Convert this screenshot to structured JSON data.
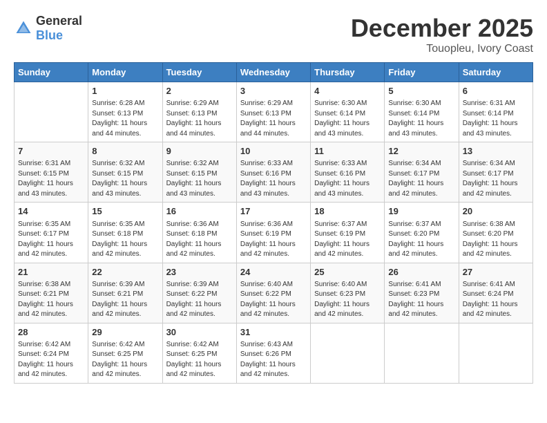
{
  "header": {
    "logo_general": "General",
    "logo_blue": "Blue",
    "month": "December 2025",
    "location": "Touopleu, Ivory Coast"
  },
  "days_of_week": [
    "Sunday",
    "Monday",
    "Tuesday",
    "Wednesday",
    "Thursday",
    "Friday",
    "Saturday"
  ],
  "weeks": [
    [
      {
        "day": "",
        "sunrise": "",
        "sunset": "",
        "daylight": ""
      },
      {
        "day": "1",
        "sunrise": "Sunrise: 6:28 AM",
        "sunset": "Sunset: 6:13 PM",
        "daylight": "Daylight: 11 hours and 44 minutes."
      },
      {
        "day": "2",
        "sunrise": "Sunrise: 6:29 AM",
        "sunset": "Sunset: 6:13 PM",
        "daylight": "Daylight: 11 hours and 44 minutes."
      },
      {
        "day": "3",
        "sunrise": "Sunrise: 6:29 AM",
        "sunset": "Sunset: 6:13 PM",
        "daylight": "Daylight: 11 hours and 44 minutes."
      },
      {
        "day": "4",
        "sunrise": "Sunrise: 6:30 AM",
        "sunset": "Sunset: 6:14 PM",
        "daylight": "Daylight: 11 hours and 43 minutes."
      },
      {
        "day": "5",
        "sunrise": "Sunrise: 6:30 AM",
        "sunset": "Sunset: 6:14 PM",
        "daylight": "Daylight: 11 hours and 43 minutes."
      },
      {
        "day": "6",
        "sunrise": "Sunrise: 6:31 AM",
        "sunset": "Sunset: 6:14 PM",
        "daylight": "Daylight: 11 hours and 43 minutes."
      }
    ],
    [
      {
        "day": "7",
        "sunrise": "Sunrise: 6:31 AM",
        "sunset": "Sunset: 6:15 PM",
        "daylight": "Daylight: 11 hours and 43 minutes."
      },
      {
        "day": "8",
        "sunrise": "Sunrise: 6:32 AM",
        "sunset": "Sunset: 6:15 PM",
        "daylight": "Daylight: 11 hours and 43 minutes."
      },
      {
        "day": "9",
        "sunrise": "Sunrise: 6:32 AM",
        "sunset": "Sunset: 6:15 PM",
        "daylight": "Daylight: 11 hours and 43 minutes."
      },
      {
        "day": "10",
        "sunrise": "Sunrise: 6:33 AM",
        "sunset": "Sunset: 6:16 PM",
        "daylight": "Daylight: 11 hours and 43 minutes."
      },
      {
        "day": "11",
        "sunrise": "Sunrise: 6:33 AM",
        "sunset": "Sunset: 6:16 PM",
        "daylight": "Daylight: 11 hours and 43 minutes."
      },
      {
        "day": "12",
        "sunrise": "Sunrise: 6:34 AM",
        "sunset": "Sunset: 6:17 PM",
        "daylight": "Daylight: 11 hours and 42 minutes."
      },
      {
        "day": "13",
        "sunrise": "Sunrise: 6:34 AM",
        "sunset": "Sunset: 6:17 PM",
        "daylight": "Daylight: 11 hours and 42 minutes."
      }
    ],
    [
      {
        "day": "14",
        "sunrise": "Sunrise: 6:35 AM",
        "sunset": "Sunset: 6:17 PM",
        "daylight": "Daylight: 11 hours and 42 minutes."
      },
      {
        "day": "15",
        "sunrise": "Sunrise: 6:35 AM",
        "sunset": "Sunset: 6:18 PM",
        "daylight": "Daylight: 11 hours and 42 minutes."
      },
      {
        "day": "16",
        "sunrise": "Sunrise: 6:36 AM",
        "sunset": "Sunset: 6:18 PM",
        "daylight": "Daylight: 11 hours and 42 minutes."
      },
      {
        "day": "17",
        "sunrise": "Sunrise: 6:36 AM",
        "sunset": "Sunset: 6:19 PM",
        "daylight": "Daylight: 11 hours and 42 minutes."
      },
      {
        "day": "18",
        "sunrise": "Sunrise: 6:37 AM",
        "sunset": "Sunset: 6:19 PM",
        "daylight": "Daylight: 11 hours and 42 minutes."
      },
      {
        "day": "19",
        "sunrise": "Sunrise: 6:37 AM",
        "sunset": "Sunset: 6:20 PM",
        "daylight": "Daylight: 11 hours and 42 minutes."
      },
      {
        "day": "20",
        "sunrise": "Sunrise: 6:38 AM",
        "sunset": "Sunset: 6:20 PM",
        "daylight": "Daylight: 11 hours and 42 minutes."
      }
    ],
    [
      {
        "day": "21",
        "sunrise": "Sunrise: 6:38 AM",
        "sunset": "Sunset: 6:21 PM",
        "daylight": "Daylight: 11 hours and 42 minutes."
      },
      {
        "day": "22",
        "sunrise": "Sunrise: 6:39 AM",
        "sunset": "Sunset: 6:21 PM",
        "daylight": "Daylight: 11 hours and 42 minutes."
      },
      {
        "day": "23",
        "sunrise": "Sunrise: 6:39 AM",
        "sunset": "Sunset: 6:22 PM",
        "daylight": "Daylight: 11 hours and 42 minutes."
      },
      {
        "day": "24",
        "sunrise": "Sunrise: 6:40 AM",
        "sunset": "Sunset: 6:22 PM",
        "daylight": "Daylight: 11 hours and 42 minutes."
      },
      {
        "day": "25",
        "sunrise": "Sunrise: 6:40 AM",
        "sunset": "Sunset: 6:23 PM",
        "daylight": "Daylight: 11 hours and 42 minutes."
      },
      {
        "day": "26",
        "sunrise": "Sunrise: 6:41 AM",
        "sunset": "Sunset: 6:23 PM",
        "daylight": "Daylight: 11 hours and 42 minutes."
      },
      {
        "day": "27",
        "sunrise": "Sunrise: 6:41 AM",
        "sunset": "Sunset: 6:24 PM",
        "daylight": "Daylight: 11 hours and 42 minutes."
      }
    ],
    [
      {
        "day": "28",
        "sunrise": "Sunrise: 6:42 AM",
        "sunset": "Sunset: 6:24 PM",
        "daylight": "Daylight: 11 hours and 42 minutes."
      },
      {
        "day": "29",
        "sunrise": "Sunrise: 6:42 AM",
        "sunset": "Sunset: 6:25 PM",
        "daylight": "Daylight: 11 hours and 42 minutes."
      },
      {
        "day": "30",
        "sunrise": "Sunrise: 6:42 AM",
        "sunset": "Sunset: 6:25 PM",
        "daylight": "Daylight: 11 hours and 42 minutes."
      },
      {
        "day": "31",
        "sunrise": "Sunrise: 6:43 AM",
        "sunset": "Sunset: 6:26 PM",
        "daylight": "Daylight: 11 hours and 42 minutes."
      },
      {
        "day": "",
        "sunrise": "",
        "sunset": "",
        "daylight": ""
      },
      {
        "day": "",
        "sunrise": "",
        "sunset": "",
        "daylight": ""
      },
      {
        "day": "",
        "sunrise": "",
        "sunset": "",
        "daylight": ""
      }
    ]
  ]
}
